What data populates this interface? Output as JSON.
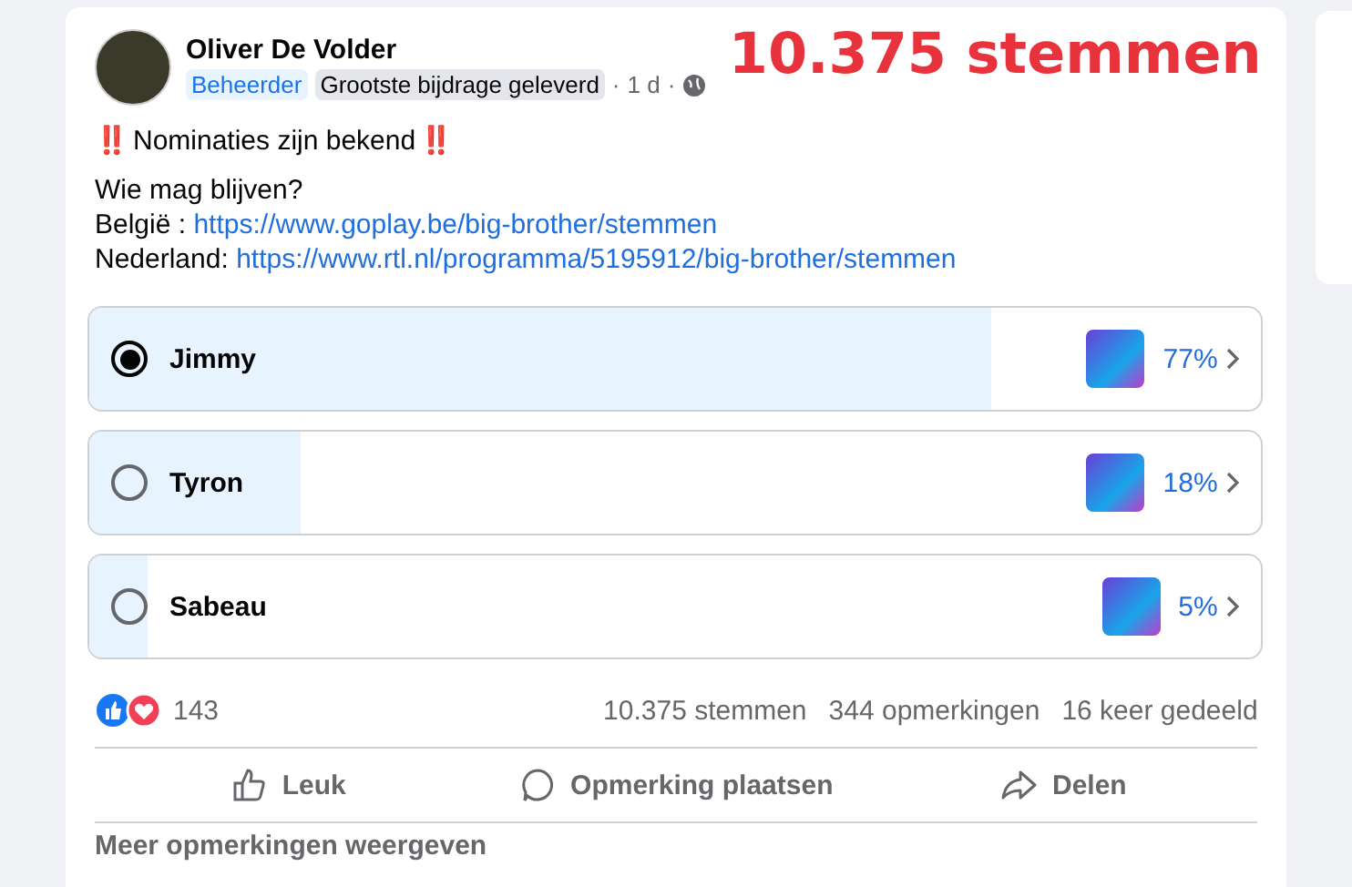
{
  "post": {
    "author": "Oliver De Volder",
    "badges": [
      {
        "label": "Beheerder",
        "kind": "role"
      },
      {
        "label": "Grootste bijdrage geleverd",
        "kind": "award"
      }
    ],
    "time": "1 d",
    "separator": "·",
    "overlay_title": "10.375 stemmen",
    "headline": "Nominaties zijn bekend",
    "headline_marks": "‼️",
    "question": "Wie mag blijven?",
    "links": [
      {
        "label": "België :",
        "url": "https://www.goplay.be/big-brother/stemmen"
      },
      {
        "label": "Nederland:",
        "url": "https://www.rtl.nl/programma/5195912/big-brother/stemmen"
      }
    ]
  },
  "poll": {
    "options": [
      {
        "name": "Jimmy",
        "selected": true,
        "level": 0.77,
        "percent": "77%"
      },
      {
        "name": "Tyron",
        "selected": false,
        "level": 0.18,
        "percent": "18%"
      },
      {
        "name": "Sabeau",
        "selected": false,
        "level": 0.05,
        "percent": "5%"
      }
    ]
  },
  "stats": {
    "reactions": "143",
    "votes": "10.375 stemmen",
    "comments": "344 opmerkingen",
    "shares": "16 keer gedeeld"
  },
  "actions": [
    {
      "kind": "like",
      "label": "Leuk"
    },
    {
      "kind": "comment",
      "label": "Opmerking plaatsen"
    },
    {
      "kind": "share",
      "label": "Delen"
    }
  ],
  "more_comments": "Meer opmerkingen weergeven"
}
